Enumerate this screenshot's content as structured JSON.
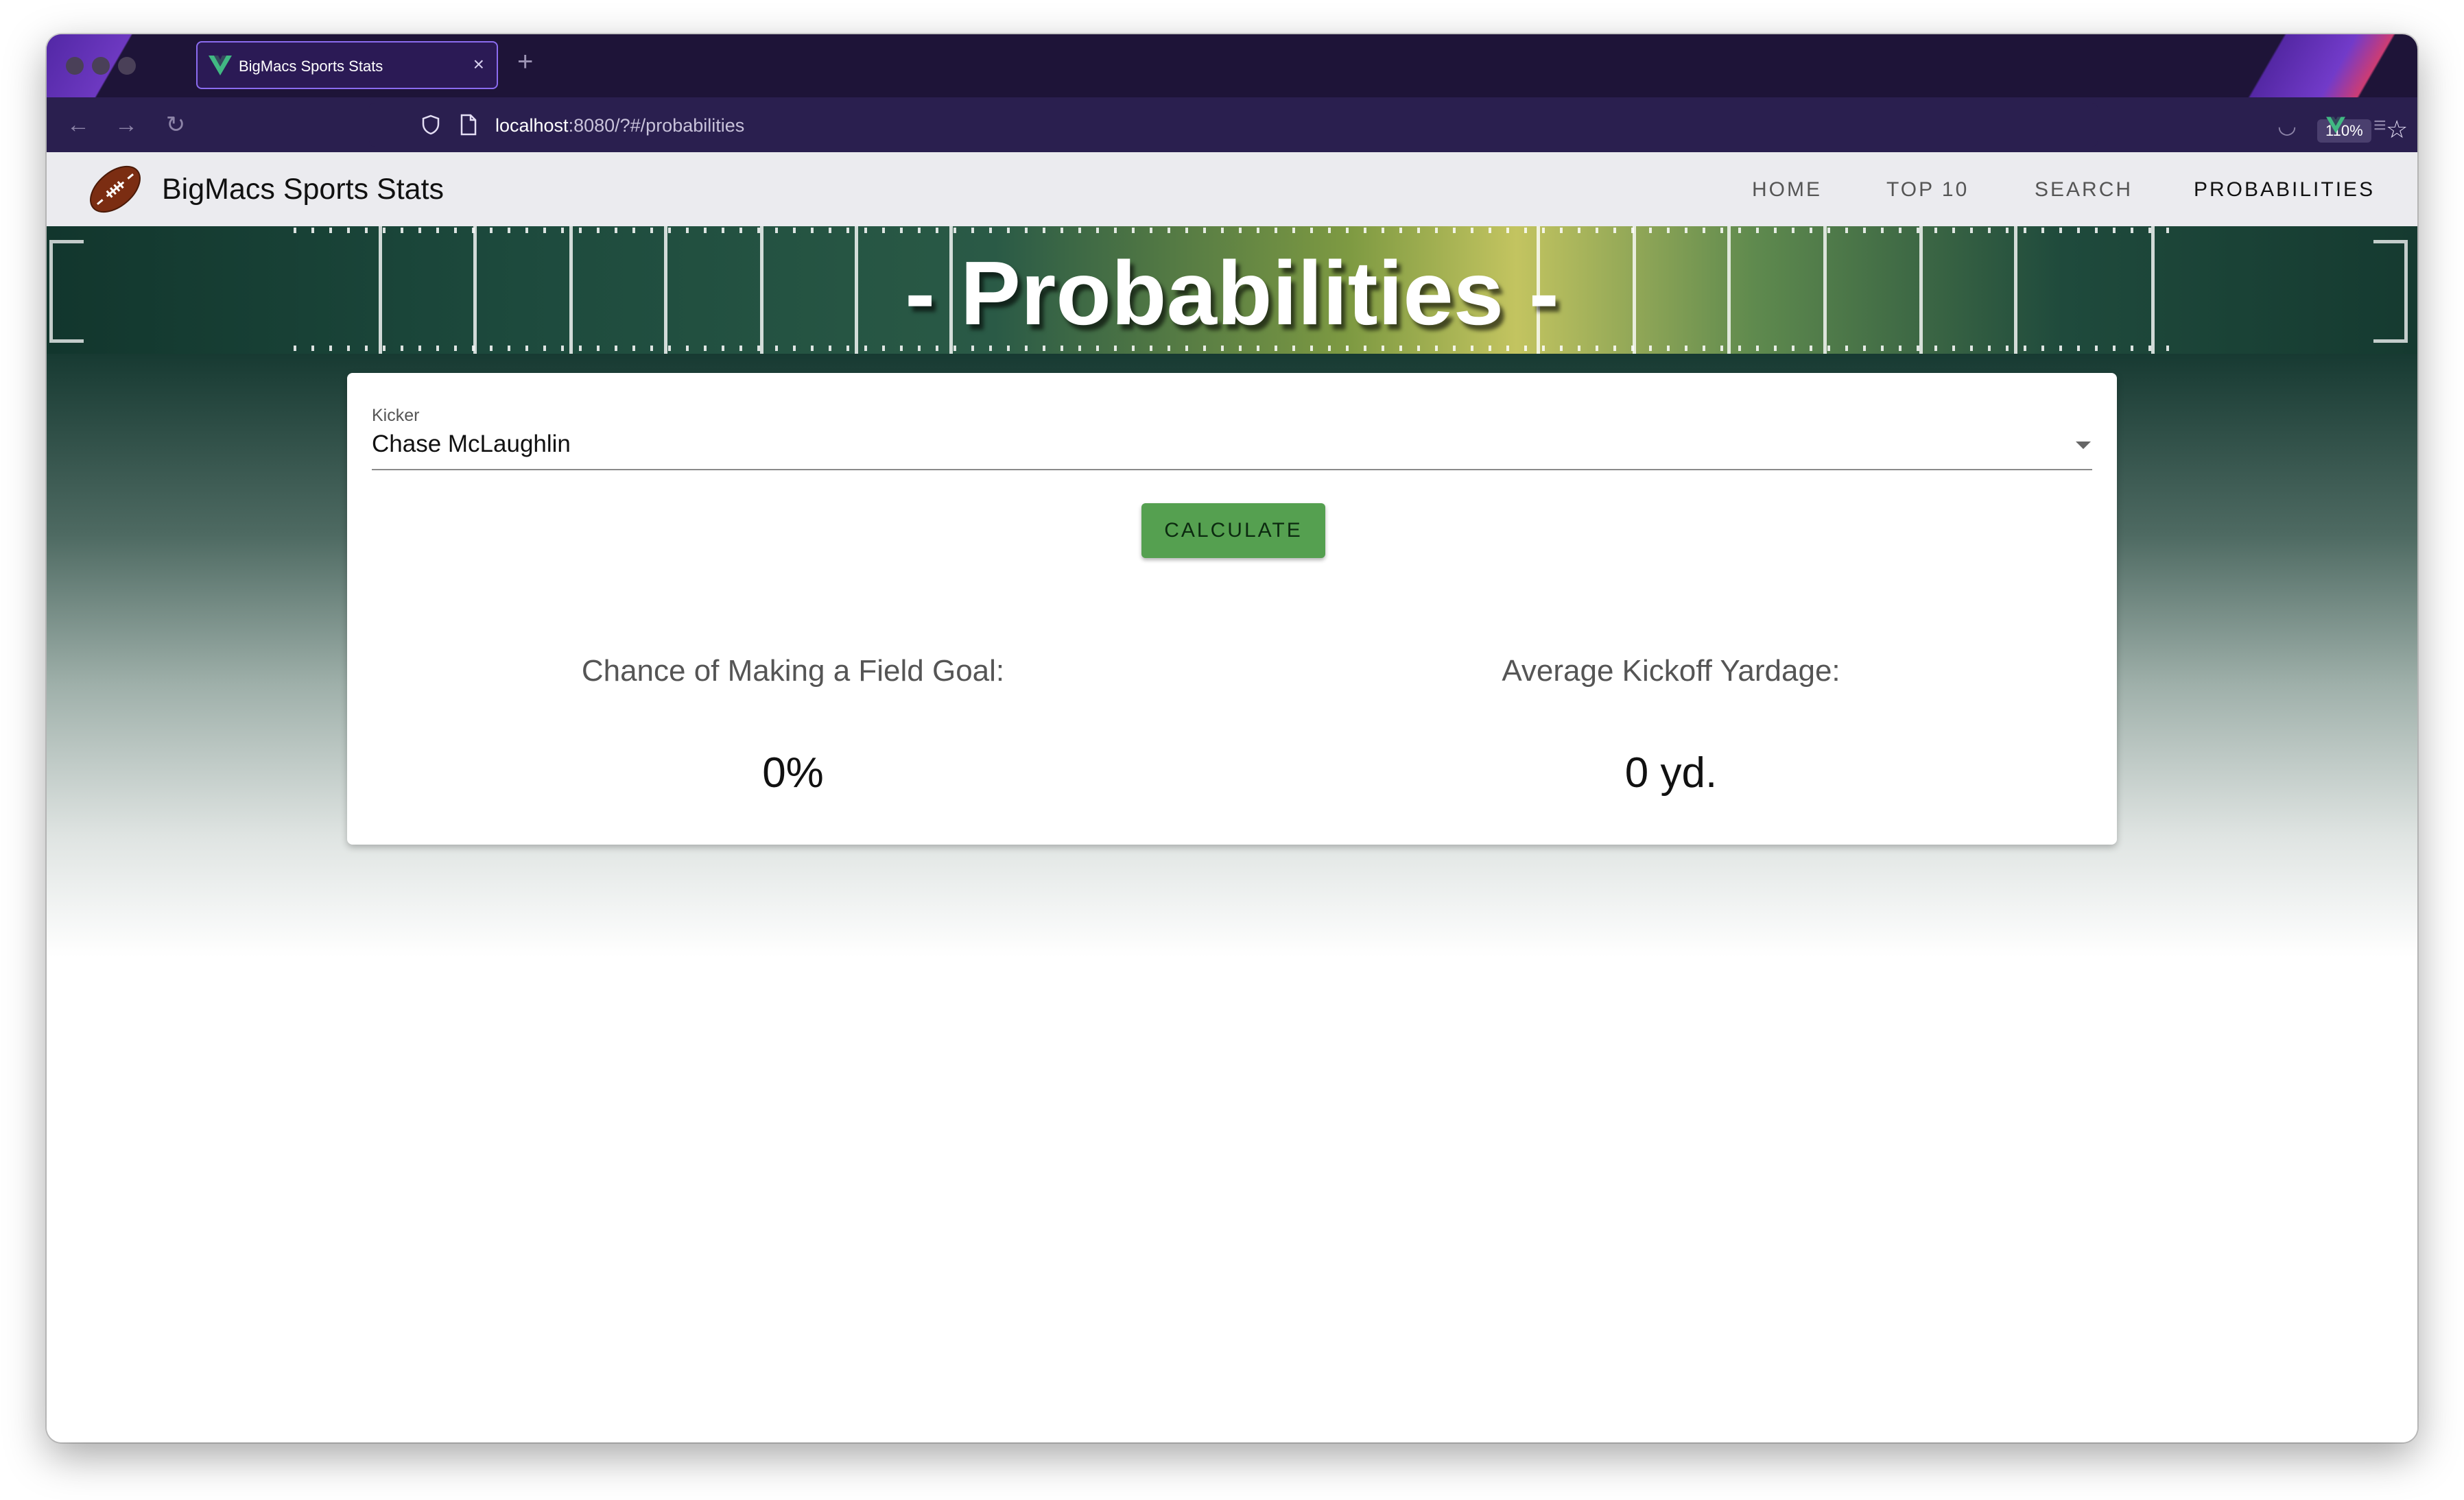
{
  "browser": {
    "tab_title": "BigMacs Sports Stats",
    "tab_close": "×",
    "new_tab": "+",
    "url_host": "localhost",
    "url_path": ":8080/?#/probabilities",
    "zoom": "110%"
  },
  "app": {
    "brand": "BigMacs Sports Stats",
    "nav": {
      "home": "HOME",
      "top10": "TOP 10",
      "search": "SEARCH",
      "probabilities": "PROBABILITIES"
    },
    "active_nav": "PROBABILITIES"
  },
  "hero": {
    "title": "- Probabilities -"
  },
  "form": {
    "kicker_label": "Kicker",
    "kicker_value": "Chase McLaughlin",
    "calculate_label": "CALCULATE"
  },
  "results": {
    "fg_label": "Chance of Making a Field Goal:",
    "fg_value": "0%",
    "kickoff_label": "Average Kickoff Yardage:",
    "kickoff_value": "0 yd."
  },
  "colors": {
    "accent_button": "#55a050",
    "browser_frame": "#1e1438",
    "appbar": "#ebebef"
  }
}
